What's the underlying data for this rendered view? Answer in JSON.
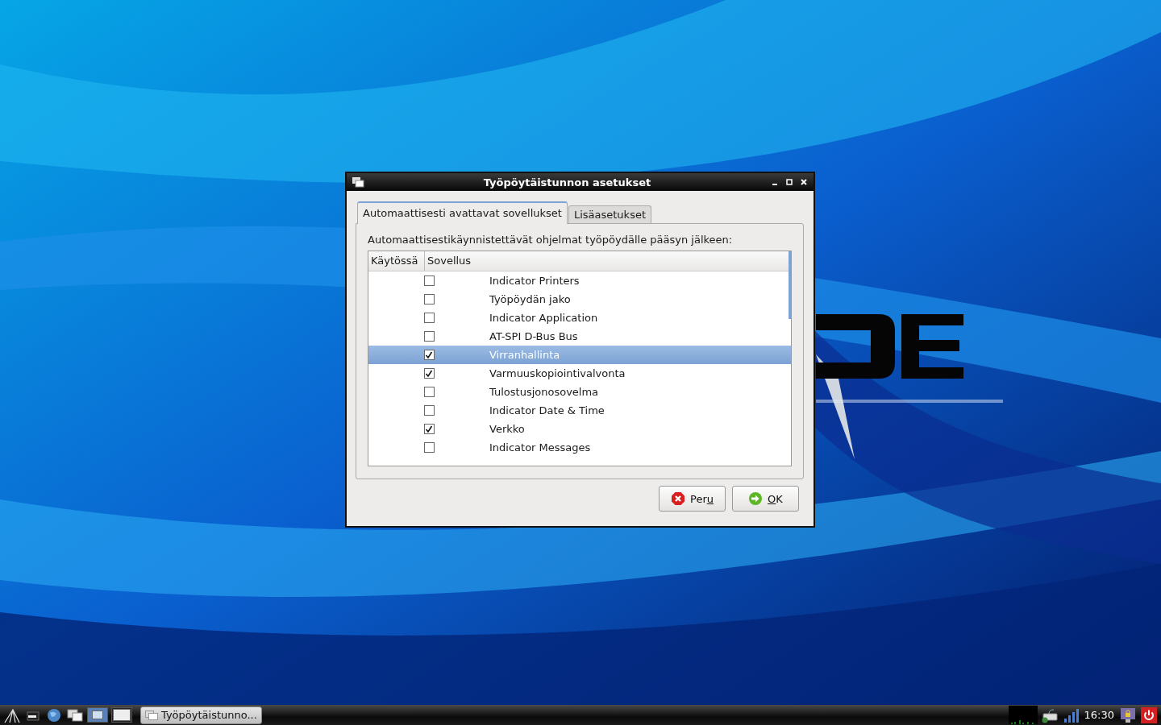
{
  "dialog": {
    "title": "Työpöytäistunnon asetukset",
    "tabs": [
      {
        "label": "Automaattisesti avattavat sovellukset",
        "selected": true
      },
      {
        "label": "Lisäasetukset",
        "selected": false
      }
    ],
    "description": "Automaattisestikäynnistettävät ohjelmat työpöydälle pääsyn jälkeen:",
    "table": {
      "columns": [
        "Käytössä",
        "Sovellus"
      ],
      "rows": [
        {
          "name": "Indicator Printers",
          "checked": false,
          "selected": false
        },
        {
          "name": "Työpöydän jako",
          "checked": false,
          "selected": false
        },
        {
          "name": "Indicator Application",
          "checked": false,
          "selected": false
        },
        {
          "name": "AT-SPI D-Bus Bus",
          "checked": false,
          "selected": false
        },
        {
          "name": "Virranhallinta",
          "checked": true,
          "selected": true
        },
        {
          "name": "Varmuuskopiointivalvonta",
          "checked": true,
          "selected": false
        },
        {
          "name": "Tulostusjonosovelma",
          "checked": false,
          "selected": false
        },
        {
          "name": "Indicator Date & Time",
          "checked": false,
          "selected": false
        },
        {
          "name": "Verkko",
          "checked": true,
          "selected": false
        },
        {
          "name": "Indicator Messages",
          "checked": false,
          "selected": false
        }
      ]
    },
    "buttons": [
      {
        "kind": "cancel",
        "label": "Per",
        "mnemonic": "u"
      },
      {
        "kind": "ok",
        "mnemonic": "O",
        "rest": "K"
      }
    ]
  },
  "taskbar": {
    "desktops": [
      {
        "selected": true
      },
      {
        "selected": false
      }
    ],
    "tasks": [
      {
        "label": "Työpöytäistunno..."
      }
    ],
    "clock": "16:30"
  }
}
